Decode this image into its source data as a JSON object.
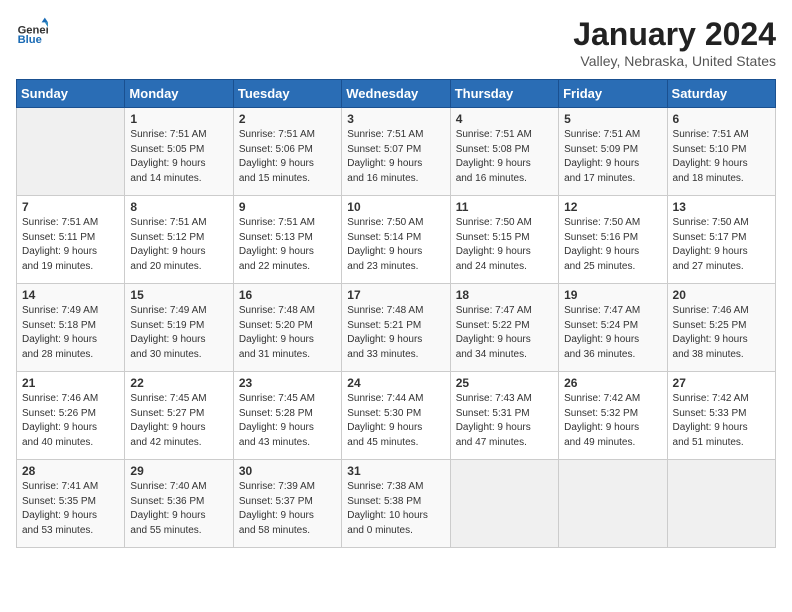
{
  "header": {
    "logo_general": "General",
    "logo_blue": "Blue",
    "month_year": "January 2024",
    "location": "Valley, Nebraska, United States"
  },
  "days_of_week": [
    "Sunday",
    "Monday",
    "Tuesday",
    "Wednesday",
    "Thursday",
    "Friday",
    "Saturday"
  ],
  "weeks": [
    [
      {
        "num": "",
        "detail": ""
      },
      {
        "num": "1",
        "detail": "Sunrise: 7:51 AM\nSunset: 5:05 PM\nDaylight: 9 hours\nand 14 minutes."
      },
      {
        "num": "2",
        "detail": "Sunrise: 7:51 AM\nSunset: 5:06 PM\nDaylight: 9 hours\nand 15 minutes."
      },
      {
        "num": "3",
        "detail": "Sunrise: 7:51 AM\nSunset: 5:07 PM\nDaylight: 9 hours\nand 16 minutes."
      },
      {
        "num": "4",
        "detail": "Sunrise: 7:51 AM\nSunset: 5:08 PM\nDaylight: 9 hours\nand 16 minutes."
      },
      {
        "num": "5",
        "detail": "Sunrise: 7:51 AM\nSunset: 5:09 PM\nDaylight: 9 hours\nand 17 minutes."
      },
      {
        "num": "6",
        "detail": "Sunrise: 7:51 AM\nSunset: 5:10 PM\nDaylight: 9 hours\nand 18 minutes."
      }
    ],
    [
      {
        "num": "7",
        "detail": "Sunrise: 7:51 AM\nSunset: 5:11 PM\nDaylight: 9 hours\nand 19 minutes."
      },
      {
        "num": "8",
        "detail": "Sunrise: 7:51 AM\nSunset: 5:12 PM\nDaylight: 9 hours\nand 20 minutes."
      },
      {
        "num": "9",
        "detail": "Sunrise: 7:51 AM\nSunset: 5:13 PM\nDaylight: 9 hours\nand 22 minutes."
      },
      {
        "num": "10",
        "detail": "Sunrise: 7:50 AM\nSunset: 5:14 PM\nDaylight: 9 hours\nand 23 minutes."
      },
      {
        "num": "11",
        "detail": "Sunrise: 7:50 AM\nSunset: 5:15 PM\nDaylight: 9 hours\nand 24 minutes."
      },
      {
        "num": "12",
        "detail": "Sunrise: 7:50 AM\nSunset: 5:16 PM\nDaylight: 9 hours\nand 25 minutes."
      },
      {
        "num": "13",
        "detail": "Sunrise: 7:50 AM\nSunset: 5:17 PM\nDaylight: 9 hours\nand 27 minutes."
      }
    ],
    [
      {
        "num": "14",
        "detail": "Sunrise: 7:49 AM\nSunset: 5:18 PM\nDaylight: 9 hours\nand 28 minutes."
      },
      {
        "num": "15",
        "detail": "Sunrise: 7:49 AM\nSunset: 5:19 PM\nDaylight: 9 hours\nand 30 minutes."
      },
      {
        "num": "16",
        "detail": "Sunrise: 7:48 AM\nSunset: 5:20 PM\nDaylight: 9 hours\nand 31 minutes."
      },
      {
        "num": "17",
        "detail": "Sunrise: 7:48 AM\nSunset: 5:21 PM\nDaylight: 9 hours\nand 33 minutes."
      },
      {
        "num": "18",
        "detail": "Sunrise: 7:47 AM\nSunset: 5:22 PM\nDaylight: 9 hours\nand 34 minutes."
      },
      {
        "num": "19",
        "detail": "Sunrise: 7:47 AM\nSunset: 5:24 PM\nDaylight: 9 hours\nand 36 minutes."
      },
      {
        "num": "20",
        "detail": "Sunrise: 7:46 AM\nSunset: 5:25 PM\nDaylight: 9 hours\nand 38 minutes."
      }
    ],
    [
      {
        "num": "21",
        "detail": "Sunrise: 7:46 AM\nSunset: 5:26 PM\nDaylight: 9 hours\nand 40 minutes."
      },
      {
        "num": "22",
        "detail": "Sunrise: 7:45 AM\nSunset: 5:27 PM\nDaylight: 9 hours\nand 42 minutes."
      },
      {
        "num": "23",
        "detail": "Sunrise: 7:45 AM\nSunset: 5:28 PM\nDaylight: 9 hours\nand 43 minutes."
      },
      {
        "num": "24",
        "detail": "Sunrise: 7:44 AM\nSunset: 5:30 PM\nDaylight: 9 hours\nand 45 minutes."
      },
      {
        "num": "25",
        "detail": "Sunrise: 7:43 AM\nSunset: 5:31 PM\nDaylight: 9 hours\nand 47 minutes."
      },
      {
        "num": "26",
        "detail": "Sunrise: 7:42 AM\nSunset: 5:32 PM\nDaylight: 9 hours\nand 49 minutes."
      },
      {
        "num": "27",
        "detail": "Sunrise: 7:42 AM\nSunset: 5:33 PM\nDaylight: 9 hours\nand 51 minutes."
      }
    ],
    [
      {
        "num": "28",
        "detail": "Sunrise: 7:41 AM\nSunset: 5:35 PM\nDaylight: 9 hours\nand 53 minutes."
      },
      {
        "num": "29",
        "detail": "Sunrise: 7:40 AM\nSunset: 5:36 PM\nDaylight: 9 hours\nand 55 minutes."
      },
      {
        "num": "30",
        "detail": "Sunrise: 7:39 AM\nSunset: 5:37 PM\nDaylight: 9 hours\nand 58 minutes."
      },
      {
        "num": "31",
        "detail": "Sunrise: 7:38 AM\nSunset: 5:38 PM\nDaylight: 10 hours\nand 0 minutes."
      },
      {
        "num": "",
        "detail": ""
      },
      {
        "num": "",
        "detail": ""
      },
      {
        "num": "",
        "detail": ""
      }
    ]
  ]
}
